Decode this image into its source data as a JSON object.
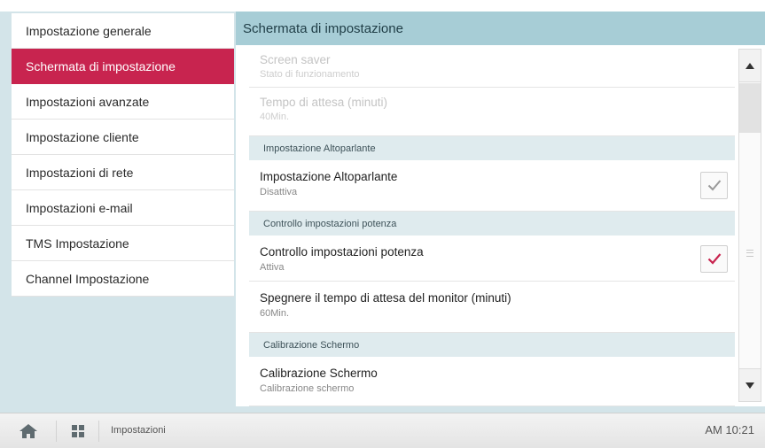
{
  "sidebar": {
    "items": [
      {
        "label": "Impostazione generale"
      },
      {
        "label": "Schermata di impostazione"
      },
      {
        "label": "Impostazioni avanzate"
      },
      {
        "label": "Impostazione cliente"
      },
      {
        "label": "Impostazioni di rete"
      },
      {
        "label": "Impostazioni e-mail"
      },
      {
        "label": "TMS Impostazione"
      },
      {
        "label": "Channel Impostazione"
      }
    ],
    "active_index": 1
  },
  "main": {
    "title": "Schermata di impostazione",
    "rows": [
      {
        "title": "Screen saver",
        "sub": "Stato di funzionamento",
        "disabled": true
      },
      {
        "title": "Tempo di attesa (minuti)",
        "sub": "40Min.",
        "disabled": true
      },
      {
        "group": "Impostazione Altoparlante"
      },
      {
        "title": "Impostazione Altoparlante",
        "sub": "Disattiva",
        "checked": false
      },
      {
        "group": "Controllo impostazioni potenza"
      },
      {
        "title": "Controllo impostazioni potenza",
        "sub": "Attiva",
        "checked": true
      },
      {
        "title": "Spegnere il tempo di attesa del monitor (minuti)",
        "sub": "60Min."
      },
      {
        "group": "Calibrazione Schermo"
      },
      {
        "title": "Calibrazione Schermo",
        "sub": "Calibrazione schermo"
      }
    ]
  },
  "bottom_bar": {
    "breadcrumb": "Impostazioni",
    "clock": "AM 10:21",
    "icons": [
      "home-icon",
      "apps-grid-icon"
    ]
  },
  "colors": {
    "accent": "#c8244f",
    "header": "#a7cdd6",
    "background": "#d3e4e9",
    "group_header": "#dfebee"
  }
}
